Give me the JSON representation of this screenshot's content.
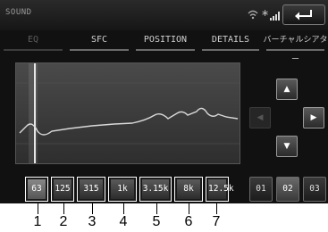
{
  "header": {
    "title": "SOUND",
    "status_icons": [
      "wifi-icon",
      "bluetooth-icon",
      "signal-icon",
      "battery-icon"
    ],
    "bluetooth_glyph": "∗",
    "back_icon": "back-arrow-icon"
  },
  "tabs": [
    {
      "label": "EQ",
      "active": false
    },
    {
      "label": "SFC",
      "active": true
    },
    {
      "label": "POSITION",
      "active": true
    },
    {
      "label": "DETAILS",
      "active": true
    },
    {
      "label": "バーチャルシアター",
      "active": true
    }
  ],
  "arrows": {
    "up": "▲",
    "down": "▼",
    "left": "◀",
    "right": "▶"
  },
  "bands": [
    {
      "label": "63",
      "selected": true
    },
    {
      "label": "125",
      "selected": false
    },
    {
      "label": "315",
      "selected": false
    },
    {
      "label": "1k",
      "selected": false
    },
    {
      "label": "3.15k",
      "selected": false
    },
    {
      "label": "8k",
      "selected": false
    },
    {
      "label": "12.5k",
      "selected": false
    }
  ],
  "presets": [
    {
      "label": "01",
      "active": false
    },
    {
      "label": "02",
      "active": true
    },
    {
      "label": "03",
      "active": false
    }
  ],
  "callouts": [
    "1",
    "2",
    "3",
    "4",
    "5",
    "6",
    "7"
  ],
  "colors": {
    "screen_bg": "#111111",
    "graph_bg": "#3a3a3a",
    "curve": "#d9d9d9",
    "band_outline": "#ffffff"
  }
}
